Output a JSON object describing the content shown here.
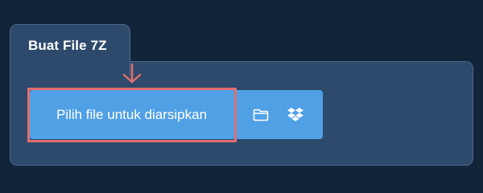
{
  "card": {
    "title": "Buat File 7Z"
  },
  "upload": {
    "choose_label": "Pilih file untuk diarsipkan",
    "icons": [
      "folder-icon",
      "dropbox-icon"
    ]
  },
  "colors": {
    "background": "#12243a",
    "panel": "#2d4a6c",
    "button": "#50a0e6",
    "highlight": "#e06e6e"
  }
}
